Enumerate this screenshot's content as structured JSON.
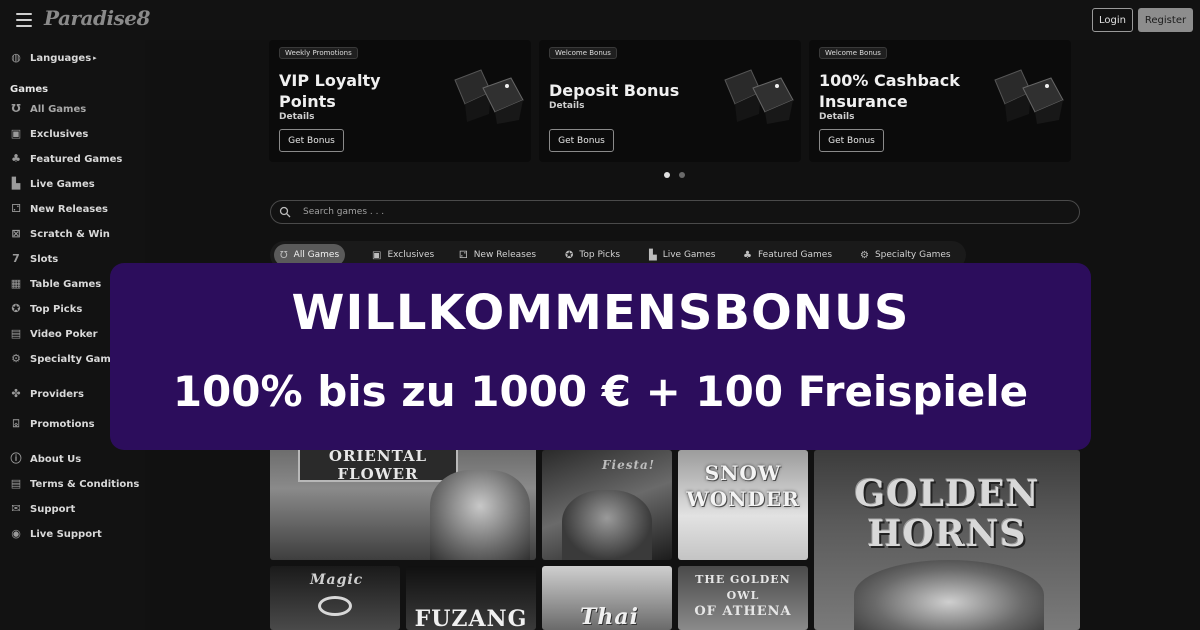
{
  "header": {
    "logo": "Paradise8",
    "login_label": "Login",
    "register_label": "Register"
  },
  "sidebar": {
    "languages": "Languages",
    "games_heading": "Games",
    "items": [
      {
        "label": "All Games",
        "icon": "horseshoe-icon"
      },
      {
        "label": "Exclusives",
        "icon": "exclusive-icon"
      },
      {
        "label": "Featured Games",
        "icon": "clover-icon"
      },
      {
        "label": "Live Games",
        "icon": "live-icon"
      },
      {
        "label": "New Releases",
        "icon": "dice-icon"
      },
      {
        "label": "Scratch & Win",
        "icon": "scratch-icon"
      },
      {
        "label": "Slots",
        "icon": "seven-icon"
      },
      {
        "label": "Table Games",
        "icon": "table-icon"
      },
      {
        "label": "Top Picks",
        "icon": "award-icon"
      },
      {
        "label": "Video Poker",
        "icon": "poker-icon"
      },
      {
        "label": "Specialty Games",
        "icon": "gear-icon"
      }
    ],
    "providers": "Providers",
    "promotions": "Promotions",
    "info": [
      {
        "label": "About Us",
        "icon": "info-icon"
      },
      {
        "label": "Terms & Conditions",
        "icon": "document-icon"
      },
      {
        "label": "Support",
        "icon": "mail-icon"
      },
      {
        "label": "Live Support",
        "icon": "chat-icon"
      }
    ]
  },
  "promos": [
    {
      "tag": "Weekly Promotions",
      "title": "VIP Loyalty Points",
      "details": "Details",
      "button": "Get Bonus"
    },
    {
      "tag": "Welcome Bonus",
      "title": "Deposit Bonus",
      "details": "Details",
      "button": "Get Bonus"
    },
    {
      "tag": "Welcome Bonus",
      "title": "100% Cashback Insurance",
      "details": "Details",
      "button": "Get Bonus"
    }
  ],
  "search": {
    "placeholder": "Search games . . ."
  },
  "tabs": [
    {
      "label": "All Games",
      "icon": "horseshoe-icon",
      "active": true
    },
    {
      "label": "Exclusives",
      "icon": "exclusive-icon"
    },
    {
      "label": "New Releases",
      "icon": "dice-icon"
    },
    {
      "label": "Top Picks",
      "icon": "award-icon"
    },
    {
      "label": "Live Games",
      "icon": "live-icon"
    },
    {
      "label": "Featured Games",
      "icon": "clover-icon"
    },
    {
      "label": "Specialty Games",
      "icon": "gear-icon"
    }
  ],
  "games": {
    "oriental_flower": "ORIENTAL FLOWER",
    "snow_wonder_1": "SNOW",
    "snow_wonder_2": "WONDER",
    "golden_horns_1": "GOLDEN",
    "golden_horns_2": "HORNS",
    "magic": "Magic",
    "fuzang": "FUZANG",
    "thai": "Thai",
    "golden_owl_1": "THE GOLDEN OWL",
    "golden_owl_2": "OF ATHENA",
    "fiesta": "Fiesta!"
  },
  "overlay": {
    "line1": "WILLKOMMENSBONUS",
    "line2": "100% bis zu 1000 € + 100 Freispiele",
    "bg_color": "#2c0d5c"
  }
}
